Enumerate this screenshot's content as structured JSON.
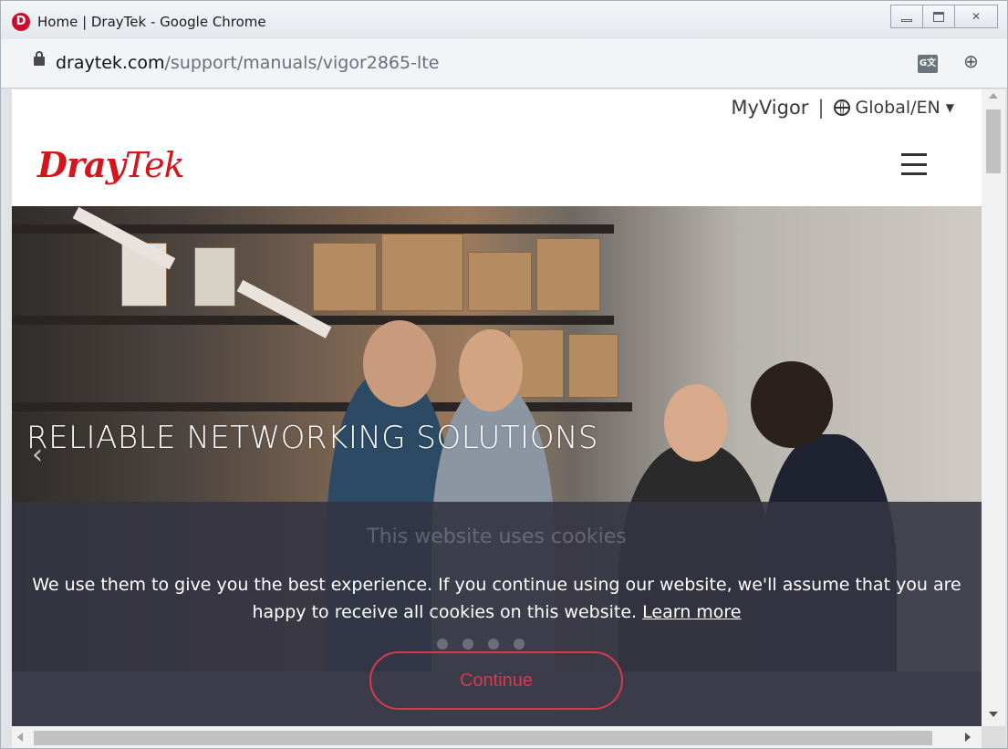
{
  "window": {
    "title": "Home | DrayTek - Google Chrome",
    "app_icon_letter": "D"
  },
  "address": {
    "host": "draytek.com",
    "path": "/support/manuals/vigor2865-lte",
    "translate_icon_text": "G文"
  },
  "header": {
    "myvigor": "MyVigor",
    "separator": "|",
    "language": "Global/EN",
    "logo_dray": "Dray",
    "logo_tek": "Tek"
  },
  "hero": {
    "title": "RELIABLE NETWORKING SOLUTIONS"
  },
  "cookie": {
    "title": "This website uses cookies",
    "message": "We use them to give you the best experience. If you continue using our website, we'll assume that you are happy to receive all cookies on this website.",
    "learn_more": "Learn more",
    "continue_label": "Continue"
  },
  "colors": {
    "brand_red": "#d4161c",
    "continue_border": "#d63a52",
    "overlay": "#343442"
  }
}
